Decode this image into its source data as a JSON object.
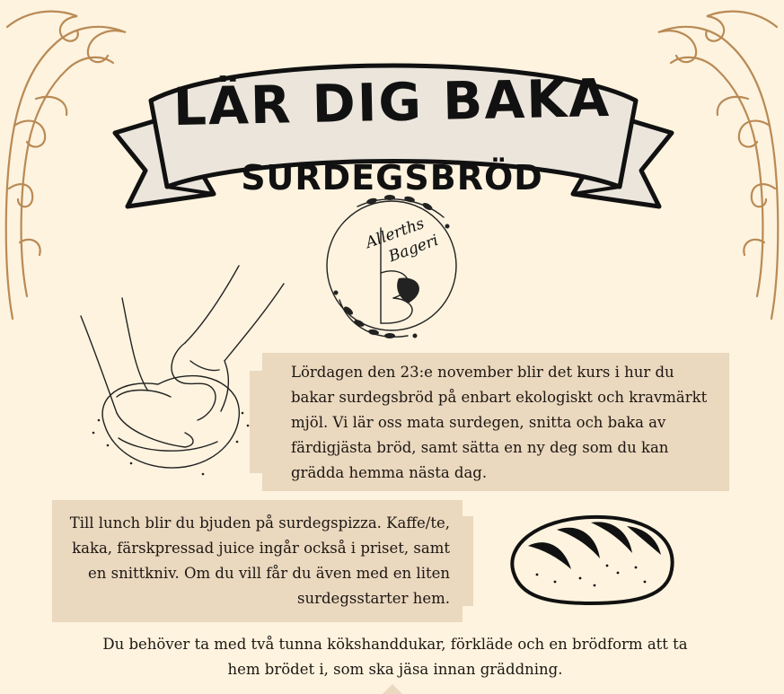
{
  "title": {
    "line1": "LÄR DIG BAKA",
    "line2": "SURDEGSBRÖD"
  },
  "logo": {
    "name_line1": "Allerths",
    "name_line2": "Bageri"
  },
  "info_box_1": {
    "text": "Lördagen den 23:e november blir det kurs i hur du bakar surdegsbröd på enbart ekologiskt och kravmärkt mjöl. Vi lär oss mata surdegen, snitta och baka av färdigjästa bröd, samt sätta en ny deg som du kan grädda hemma nästa dag."
  },
  "info_box_2": {
    "text": "Till lunch blir du bjuden på surdegspizza. Kaffe/te, kaka, färskpressad juice ingår också i priset, samt en snittkniv. Om du vill får du även med en liten surdegsstarter hem."
  },
  "bottom": {
    "text": "Du behöver ta med två tunna kökshanddukar, förkläde och en brödform att ta hem brödet i, som ska jäsa innan gräddning."
  },
  "colors": {
    "background": "#fdf3df",
    "box": "#ead8bf",
    "flourish": "#b98a55",
    "ink": "#111111"
  },
  "icons": [
    "corner-flourish-icon",
    "ribbon-banner-icon",
    "wreath-logo-icon",
    "kneading-hands-icon",
    "bread-loaf-icon",
    "arrow-down-icon"
  ]
}
